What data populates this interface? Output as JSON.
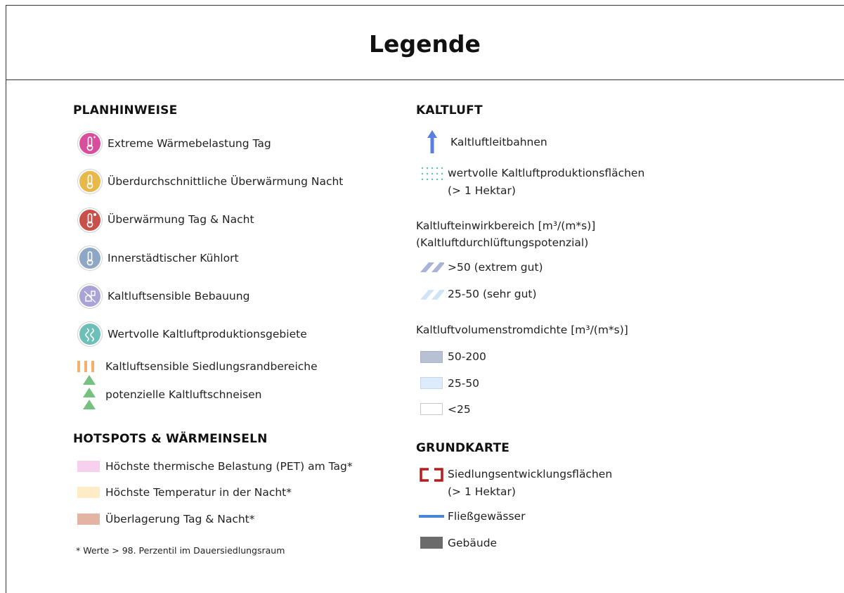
{
  "legend": {
    "title": "Legende",
    "planhinweise": {
      "heading": "PLANHINWEISE",
      "items": [
        {
          "label": "Extreme Wärmebelastung Tag",
          "color": "#d94e9c"
        },
        {
          "label": "Überdurchschnittliche Überwärmung Nacht",
          "color": "#e8b84a"
        },
        {
          "label": "Überwärmung Tag & Nacht",
          "color": "#c9504a"
        },
        {
          "label": "Innerstädtischer Kühlort",
          "color": "#8ea7c4"
        },
        {
          "label": "Kaltluftsensible Bebauung",
          "color": "#a9a3d6"
        },
        {
          "label": "Wertvolle Kaltluftproduktionsgebiete",
          "color": "#6cc0b8"
        },
        {
          "label": "Kaltluftsensible Siedlungsrandbereiche",
          "color": "#f5b06b"
        },
        {
          "label": "potenzielle Kaltluftschneisen",
          "color": "#76c17f"
        }
      ]
    },
    "hotspots": {
      "heading": "HOTSPOTS & WÄRMEINSELN",
      "items": [
        {
          "label": "Höchste thermische Belastung (PET) am Tag*",
          "color": "#f6d0ee"
        },
        {
          "label": "Höchste Temperatur in der Nacht*",
          "color": "#fdecc6"
        },
        {
          "label": "Überlagerung Tag & Nacht*",
          "color": "#e3b3a4"
        }
      ],
      "footnote": "* Werte > 98. Perzentil im Dauersiedlungsraum"
    },
    "kaltluft": {
      "heading": "KALTLUFT",
      "leitbahnen": {
        "label": "Kaltluftleitbahnen",
        "color": "#5b7fe0"
      },
      "produktion": {
        "label_1": "wertvolle Kaltluftproduktionsflächen",
        "label_2": "(> 1 Hektar)",
        "color": "#5fc1ae"
      },
      "einwirk": {
        "title_1": "Kaltlufteinwirkbereich [m³/(m*s)]",
        "title_2": "(Kaltluftdurchlüftungspotenzial)",
        "items": [
          {
            "label": ">50 (extrem gut)",
            "color": "#aab4d8"
          },
          {
            "label": "25-50 (sehr gut)",
            "color": "#cfe4f6"
          }
        ]
      },
      "volumen": {
        "title": "Kaltluftvolumenstromdichte [m³/(m*s)]",
        "items": [
          {
            "label": "50-200",
            "color": "#b8c0d4"
          },
          {
            "label": "25-50",
            "color": "#dcecfa"
          },
          {
            "label": "<25",
            "color": "#ffffff"
          }
        ]
      }
    },
    "grundkarte": {
      "heading": "GRUNDKARTE",
      "items": [
        {
          "label_1": "Siedlungsentwicklungsflächen",
          "label_2": "(> 1 Hektar)",
          "color": "#b81c1c"
        },
        {
          "label": "Fließgewässer",
          "color": "#4a86d6"
        },
        {
          "label": "Gebäude",
          "color": "#6b6b6b"
        }
      ]
    }
  }
}
